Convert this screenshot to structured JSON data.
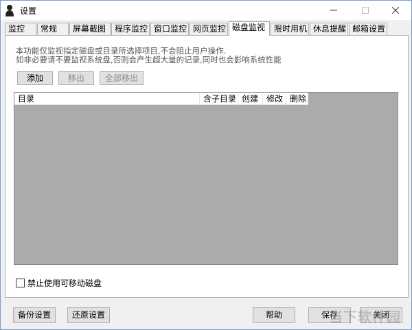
{
  "window": {
    "title": "设置",
    "app_icon": "person-icon"
  },
  "tabs": [
    {
      "label": "监控",
      "active": false
    },
    {
      "label": "常规",
      "active": false
    },
    {
      "label": "屏幕截图",
      "active": false
    },
    {
      "label": "程序监控",
      "active": false
    },
    {
      "label": "窗口监控",
      "active": false
    },
    {
      "label": "网页监控",
      "active": false
    },
    {
      "label": "磁盘监视",
      "active": true
    },
    {
      "label": "限时用机",
      "active": false
    },
    {
      "label": "休息提醒",
      "active": false
    },
    {
      "label": "邮箱设置",
      "active": false
    }
  ],
  "panel": {
    "desc_line1": "本功能仅监视指定磁盘或目录所选择项目,不会阻止用户操作.",
    "desc_line2": "如非必要请不要监视系统盘,否则会产生超大量的记录,同时也会影响系统性能",
    "add_label": "添加",
    "remove_label": "移出",
    "remove_all_label": "全部移出",
    "columns": [
      "目录",
      "含子目录",
      "创建",
      "修改",
      "删除"
    ],
    "disable_removable_label": "禁止使用可移动磁盘",
    "disable_removable_checked": false
  },
  "footer": {
    "backup_label": "备份设置",
    "restore_label": "还原设置",
    "help_label": "帮助",
    "save_label": "保存",
    "close_label": "关闭"
  },
  "watermark": "当下软件园"
}
